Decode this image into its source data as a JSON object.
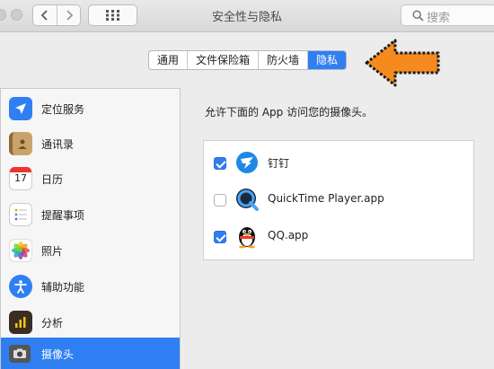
{
  "window": {
    "title": "安全性与隐私",
    "search_placeholder": "搜索",
    "nav_back_glyph": "‹",
    "nav_forward_glyph": "›"
  },
  "tabs": [
    {
      "label": "通用",
      "active": false
    },
    {
      "label": "文件保险箱",
      "active": false
    },
    {
      "label": "防火墙",
      "active": false
    },
    {
      "label": "隐私",
      "active": true
    }
  ],
  "sidebar": {
    "items": [
      {
        "label": "定位服务",
        "icon": "location-arrow-icon",
        "selected": false
      },
      {
        "label": "通讯录",
        "icon": "contacts-book-icon",
        "selected": false
      },
      {
        "label": "日历",
        "icon": "calendar-icon",
        "selected": false,
        "icon_text": "17"
      },
      {
        "label": "提醒事项",
        "icon": "reminders-icon",
        "selected": false
      },
      {
        "label": "照片",
        "icon": "photos-icon",
        "selected": false
      },
      {
        "label": "辅助功能",
        "icon": "accessibility-icon",
        "selected": false
      },
      {
        "label": "分析",
        "icon": "analytics-icon",
        "selected": false
      },
      {
        "label": "摄像头",
        "icon": "camera-icon",
        "selected": true
      }
    ]
  },
  "content": {
    "prompt": "允许下面的 App 访问您的摄像头。",
    "apps": [
      {
        "name": "钉钉",
        "checked": true,
        "icon": "dingtalk-icon"
      },
      {
        "name": "QuickTime Player.app",
        "checked": false,
        "icon": "quicktime-icon"
      },
      {
        "name": "QQ.app",
        "checked": true,
        "icon": "qq-penguin-icon"
      }
    ]
  },
  "colors": {
    "accent": "#2f7ff2",
    "annotation_arrow": "#f58a1f"
  }
}
